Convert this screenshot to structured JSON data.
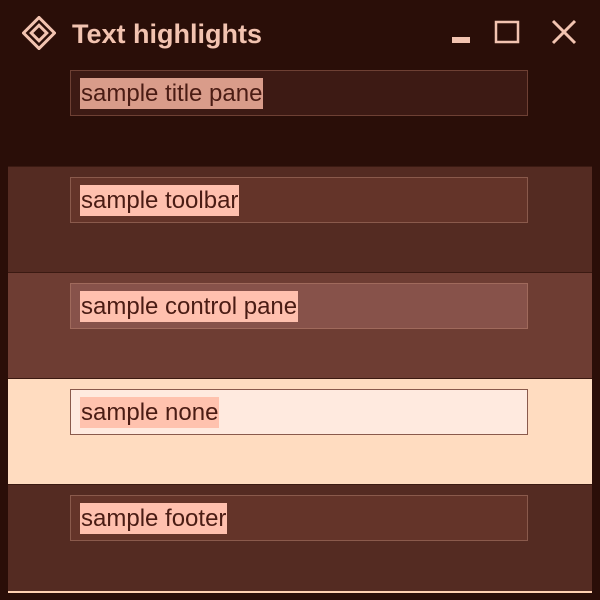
{
  "window": {
    "title": "Text highlights",
    "icons": {
      "app": "diamond-app-icon",
      "minimize": "minimize-icon",
      "maximize": "maximize-icon",
      "close": "close-icon"
    }
  },
  "samples": [
    {
      "label": "sample title pane"
    },
    {
      "label": "sample toolbar"
    },
    {
      "label": "sample control pane"
    },
    {
      "label": "sample none"
    },
    {
      "label": "sample footer"
    }
  ],
  "colors": {
    "title_bg": "#2a0e08",
    "toolbar_bg": "#542b22",
    "control_bg": "#6e3d33",
    "none_bg": "#ffdcc0",
    "footer_bg": "#542b22",
    "accent": "#f2c3b0",
    "highlight": "#ffc0ae"
  }
}
